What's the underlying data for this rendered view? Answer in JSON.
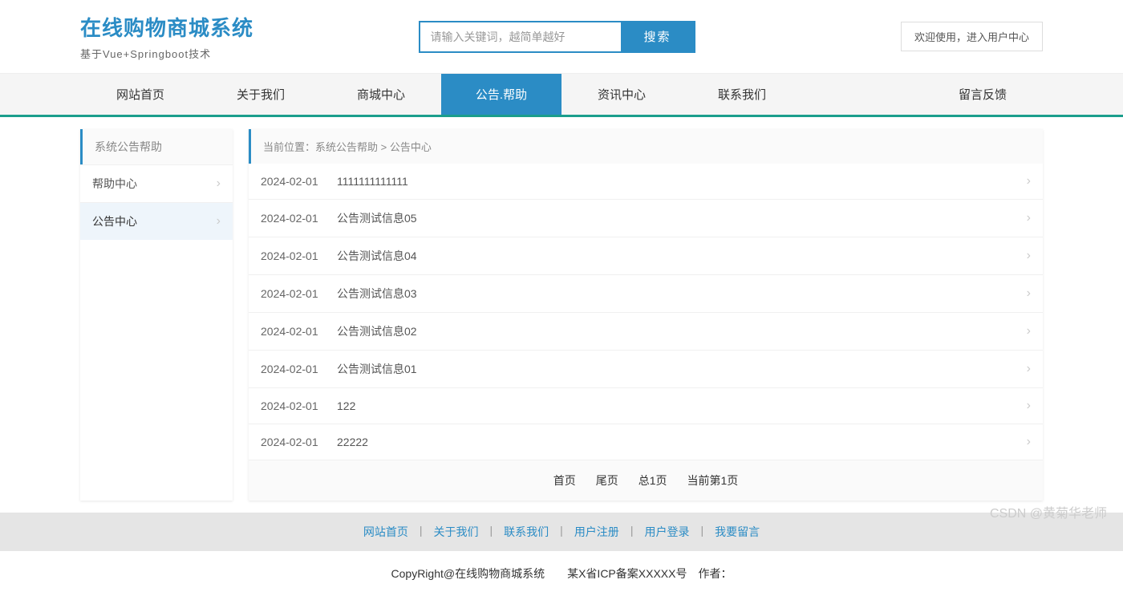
{
  "header": {
    "title": "在线购物商城系统",
    "subtitle": "基于Vue+Springboot技术",
    "search_placeholder": "请输入关键词，越简单越好",
    "search_button": "搜索",
    "user_link": "欢迎使用，进入用户中心"
  },
  "nav": {
    "items": [
      "网站首页",
      "关于我们",
      "商城中心",
      "公告.帮助",
      "资讯中心",
      "联系我们"
    ],
    "feedback": "留言反馈",
    "active_index": 3
  },
  "sidebar": {
    "header": "系统公告帮助",
    "items": [
      {
        "label": "帮助中心",
        "active": false
      },
      {
        "label": "公告中心",
        "active": true
      }
    ]
  },
  "breadcrumb": "当前位置：系统公告帮助 > 公告中心",
  "list": [
    {
      "date": "2024-02-01",
      "title": "1111111111111"
    },
    {
      "date": "2024-02-01",
      "title": "公告测试信息05"
    },
    {
      "date": "2024-02-01",
      "title": "公告测试信息04"
    },
    {
      "date": "2024-02-01",
      "title": "公告测试信息03"
    },
    {
      "date": "2024-02-01",
      "title": "公告测试信息02"
    },
    {
      "date": "2024-02-01",
      "title": "公告测试信息01"
    },
    {
      "date": "2024-02-01",
      "title": "122"
    },
    {
      "date": "2024-02-01",
      "title": "22222"
    }
  ],
  "pagination": {
    "first": "首页",
    "last": "尾页",
    "total": "总1页",
    "current": "当前第1页"
  },
  "footer": {
    "links": [
      "网站首页",
      "关于我们",
      "联系我们",
      "用户注册",
      "用户登录",
      "我要留言"
    ],
    "copyright": "CopyRight@在线购物商城系统　　某X省ICP备案XXXXX号　作者："
  },
  "watermark": "CSDN @黄菊华老师"
}
